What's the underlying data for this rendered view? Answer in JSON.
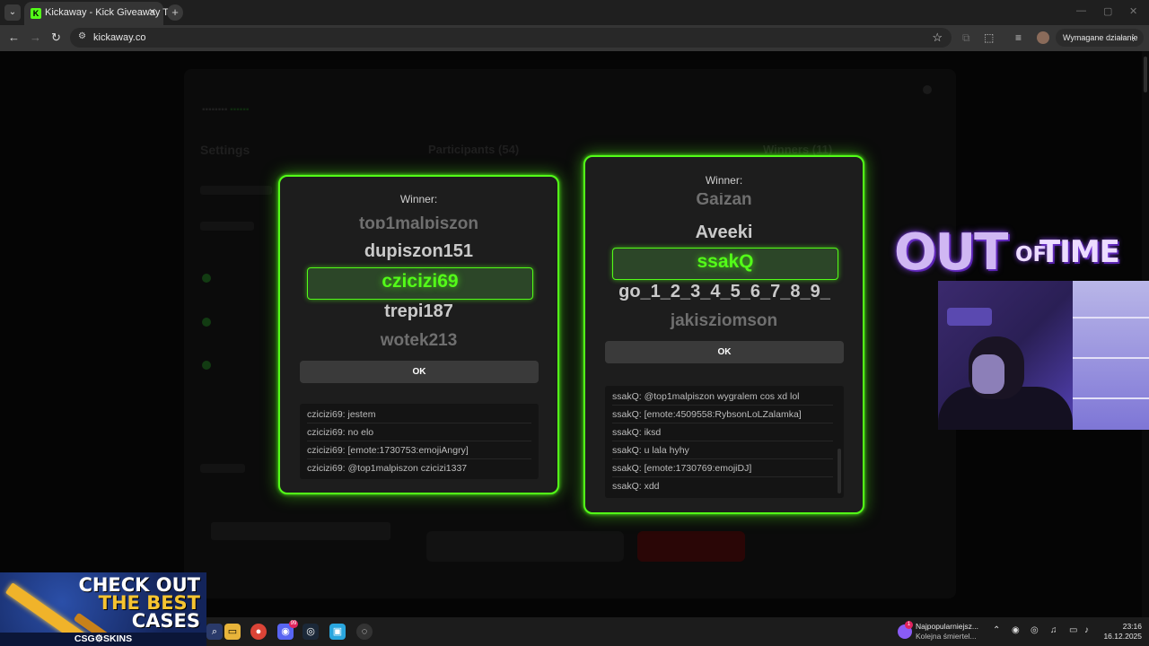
{
  "browser": {
    "tab_title": "Kickaway - Kick Giveaway Tool",
    "url": "kickaway.co",
    "profile_action": "Wymagane działanie",
    "icons": [
      "tab-search-icon",
      "close-icon",
      "plus-icon",
      "back-icon",
      "forward-icon",
      "reload-icon",
      "site-info-icon",
      "star-icon",
      "extensions-icon",
      "media-icon",
      "more-icon"
    ]
  },
  "background_app": {
    "heading_settings": "Settings",
    "heading_participants": "Participants (54)",
    "heading_winners": "Winners (11)"
  },
  "modal_left": {
    "winner_label": "Winner:",
    "reel": [
      "top1malpiszon",
      "dupiszon151",
      "czicizi69",
      "trepi187",
      "wotek213"
    ],
    "selected": "czicizi69",
    "ok_label": "OK",
    "chat": [
      "czicizi69: jestem",
      "czicizi69: no elo",
      "czicizi69: [emote:1730753:emojiAngry]",
      "czicizi69: @top1malpiszon czicizi1337"
    ]
  },
  "modal_right": {
    "winner_label": "Winner:",
    "reel": [
      "Gaizan",
      "Aveeki",
      "ssakQ",
      "go_1_2_3_4_5_6_7_8_9_",
      "jakisziomson"
    ],
    "selected": "ssakQ",
    "ok_label": "OK",
    "chat": [
      "ssakQ: @top1malpiszon wygralem cos xd lol",
      "ssakQ: [emote:4509558:RybsonLoLZalamka]",
      "ssakQ: iksd",
      "ssakQ: u lala hyhy",
      "ssakQ: [emote:1730769:emojiDJ]",
      "ssakQ: xdd"
    ]
  },
  "overlay": {
    "brand_out": "OUT",
    "brand_of": "OF",
    "brand_time": "TIME",
    "ad_line1": "CHECK OUT",
    "ad_line2": "THE BEST",
    "ad_line3": "CASES",
    "ad_brand": "CSG⚙SKINS"
  },
  "taskbar": {
    "notification_title": "Najpopularniejsz...",
    "notification_sub": "Kolejna śmiertel...",
    "time": "23:16",
    "date": "16.12.2025",
    "discord_badge": "99"
  },
  "colors": {
    "kick_green": "#53fc18",
    "modal_bg": "#1d1d1d"
  }
}
